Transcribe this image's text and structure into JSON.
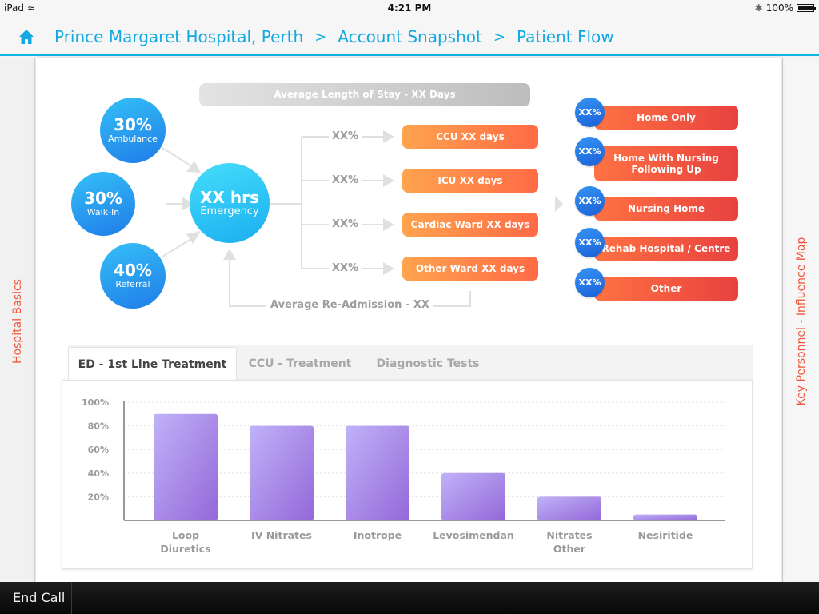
{
  "status_bar": {
    "device": "iPad",
    "time": "4:21 PM",
    "battery": "100%"
  },
  "breadcrumb": {
    "items": [
      "Prince Margaret Hospital, Perth",
      "Account Snapshot",
      "Patient Flow"
    ],
    "separator": ">"
  },
  "side_tabs": {
    "left": "Hospital Basics",
    "right": "Key Personnel - Influence Map"
  },
  "flow": {
    "sources": [
      {
        "pct": "30%",
        "label": "Ambulance"
      },
      {
        "pct": "30%",
        "label": "Walk-In"
      },
      {
        "pct": "40%",
        "label": "Referral"
      }
    ],
    "emergency": {
      "value": "XX hrs",
      "label": "Emergency"
    },
    "length_of_stay": "Average Length of Stay - XX Days",
    "wards": [
      {
        "pct": "XX%",
        "label": "CCU XX days"
      },
      {
        "pct": "XX%",
        "label": "ICU XX days"
      },
      {
        "pct": "XX%",
        "label": "Cardiac Ward XX days"
      },
      {
        "pct": "XX%",
        "label": "Other Ward XX days"
      }
    ],
    "readmission": "Average Re-Admission - XX",
    "destinations": [
      {
        "pct": "XX%",
        "label": "Home Only"
      },
      {
        "pct": "XX%",
        "label": "Home With Nursing Following Up"
      },
      {
        "pct": "XX%",
        "label": "Nursing Home"
      },
      {
        "pct": "XX%",
        "label": "Rehab Hospital / Centre"
      },
      {
        "pct": "XX%",
        "label": "Other"
      }
    ]
  },
  "tabs": [
    {
      "label": "ED - 1st Line Treatment",
      "active": true
    },
    {
      "label": "CCU - Treatment",
      "active": false
    },
    {
      "label": "Diagnostic Tests",
      "active": false
    }
  ],
  "chart_data": {
    "type": "bar",
    "title": "",
    "xlabel": "",
    "ylabel": "",
    "categories": [
      "Loop Diuretics",
      "IV Nitrates",
      "Inotrope",
      "Levosimendan",
      "Nitrates Other",
      "Nesiritide"
    ],
    "category_lines": [
      [
        "Loop",
        "Diuretics"
      ],
      [
        "IV Nitrates"
      ],
      [
        "Inotrope"
      ],
      [
        "Levosimendan"
      ],
      [
        "Nitrates",
        "Other"
      ],
      [
        "Nesiritide"
      ]
    ],
    "values": [
      90,
      80,
      80,
      40,
      20,
      5
    ],
    "ylim": [
      0,
      100
    ],
    "yticks": [
      20,
      40,
      60,
      80,
      100
    ],
    "ytick_labels": [
      "20%",
      "40%",
      "60%",
      "80%",
      "100%"
    ],
    "grid": true,
    "legend": "none",
    "bar_colors": [
      "#c0b2f8",
      "#9468d8"
    ]
  },
  "bottom_bar": {
    "end_call": "End Call"
  },
  "colors": {
    "accent": "#12a9e0",
    "side_tab_text": "#f0553a",
    "ward_orange": "#ff8a48",
    "destination_red": "#f05a40",
    "source_blue": "#1f7ce8"
  }
}
